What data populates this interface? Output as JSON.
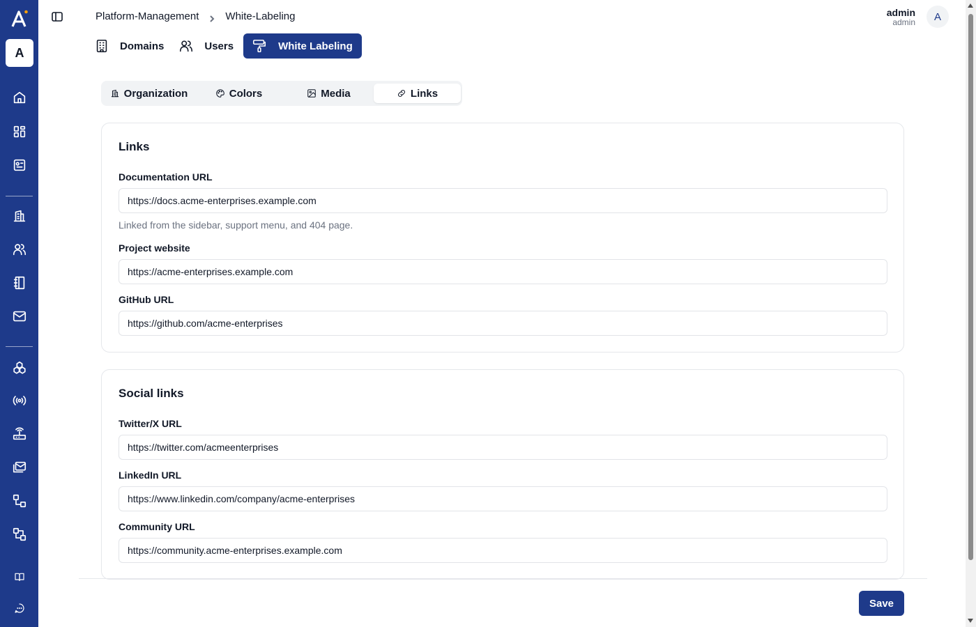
{
  "app": {
    "org_initial": "A",
    "brand_color": "#1e3a8a",
    "logo_icon": "acme-a-logo-icon"
  },
  "rail": {
    "items": [
      {
        "icon": "home-icon"
      },
      {
        "icon": "dashboard-grid-icon"
      },
      {
        "icon": "apps-icon"
      },
      {
        "icon": "building-icon"
      },
      {
        "icon": "users-icon"
      },
      {
        "icon": "notebook-icon"
      },
      {
        "icon": "mail-icon"
      },
      {
        "icon": "blocks-icon"
      },
      {
        "icon": "broadcast-icon"
      },
      {
        "icon": "router-icon"
      },
      {
        "icon": "mail-stack-icon"
      },
      {
        "icon": "workflow-icon"
      },
      {
        "icon": "flow-icon"
      },
      {
        "icon": "book-icon"
      },
      {
        "icon": "chat-icon"
      }
    ]
  },
  "breadcrumb": {
    "items": [
      "Platform-Management",
      "White-Labeling"
    ]
  },
  "user": {
    "name": "admin",
    "role": "admin",
    "avatar_initial": "A"
  },
  "top_tabs": [
    {
      "label": "Domains",
      "icon": "building-icon",
      "active": false
    },
    {
      "label": "Users",
      "icon": "users-icon",
      "active": false
    },
    {
      "label": "White Labeling",
      "icon": "paint-roller-icon",
      "active": true
    }
  ],
  "section_tabs": [
    {
      "label": "Organization",
      "icon": "building-icon",
      "active": false
    },
    {
      "label": "Colors",
      "icon": "palette-icon",
      "active": false
    },
    {
      "label": "Media",
      "icon": "image-icon",
      "active": false
    },
    {
      "label": "Links",
      "icon": "link-icon",
      "active": true
    }
  ],
  "links_card": {
    "title": "Links",
    "documentation": {
      "label": "Documentation URL",
      "value": "https://docs.acme-enterprises.example.com",
      "hint": "Linked from the sidebar, support menu, and 404 page."
    },
    "website": {
      "label": "Project website",
      "value": "https://acme-enterprises.example.com"
    },
    "github": {
      "label": "GitHub URL",
      "value": "https://github.com/acme-enterprises"
    }
  },
  "social_card": {
    "title": "Social links",
    "twitter": {
      "label": "Twitter/X URL",
      "value": "https://twitter.com/acmeenterprises"
    },
    "linkedin": {
      "label": "LinkedIn URL",
      "value": "https://www.linkedin.com/company/acme-enterprises"
    },
    "community": {
      "label": "Community URL",
      "value": "https://community.acme-enterprises.example.com"
    }
  },
  "footer": {
    "save_label": "Save"
  }
}
